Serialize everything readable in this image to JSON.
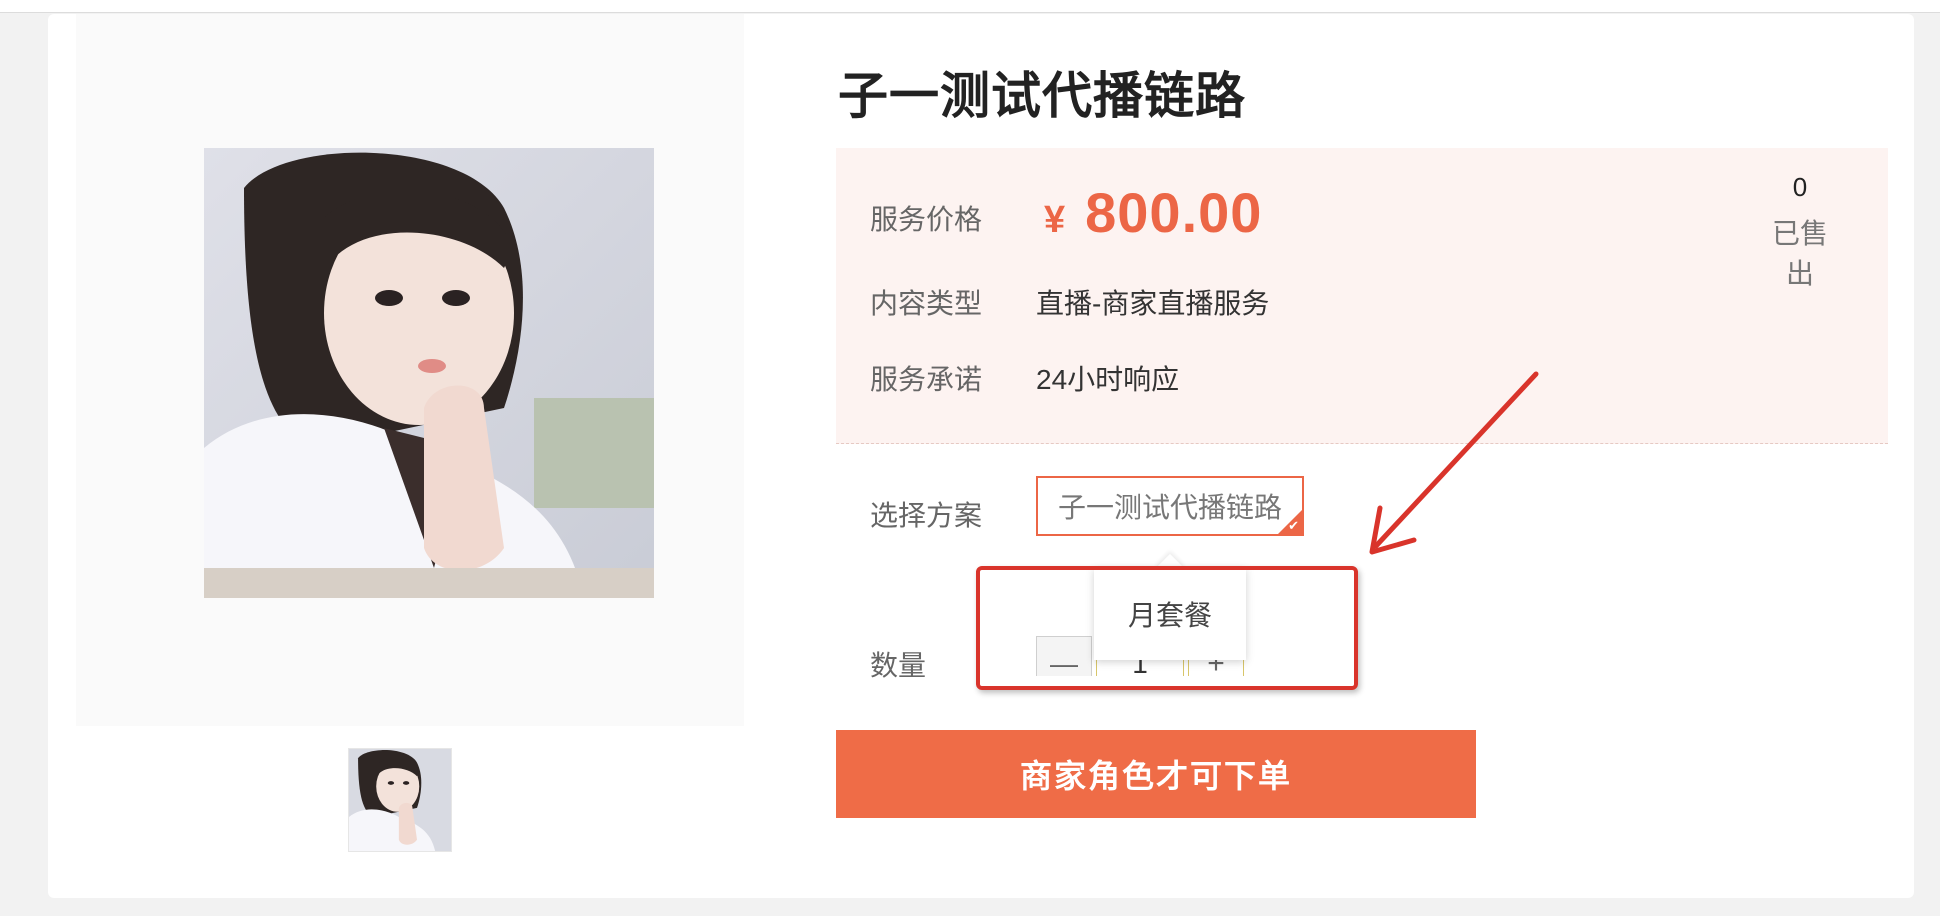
{
  "product": {
    "title": "子一测试代播链路"
  },
  "info": {
    "price_label": "服务价格",
    "price_symbol": "¥",
    "price_value": "800.00",
    "sold_count": "0",
    "sold_label": "已售出",
    "content_type_label": "内容类型",
    "content_type_value": "直播-商家直播服务",
    "promise_label": "服务承诺",
    "promise_value": "24小时响应"
  },
  "plan": {
    "label": "选择方案",
    "selected_option": "子一测试代播链路",
    "tooltip_text": "月套餐"
  },
  "quantity": {
    "label": "数量",
    "minus_symbol": "—",
    "value": "1",
    "plus_symbol": "+"
  },
  "order_button_label": "商家角色才可下单",
  "colors": {
    "accent": "#ec6646",
    "button": "#ef6c47",
    "annotation_red": "#d9342b",
    "info_bg": "#fdf3f1"
  },
  "icons": {
    "selected_check": "check-icon",
    "annotation_arrow": "arrow-icon"
  }
}
